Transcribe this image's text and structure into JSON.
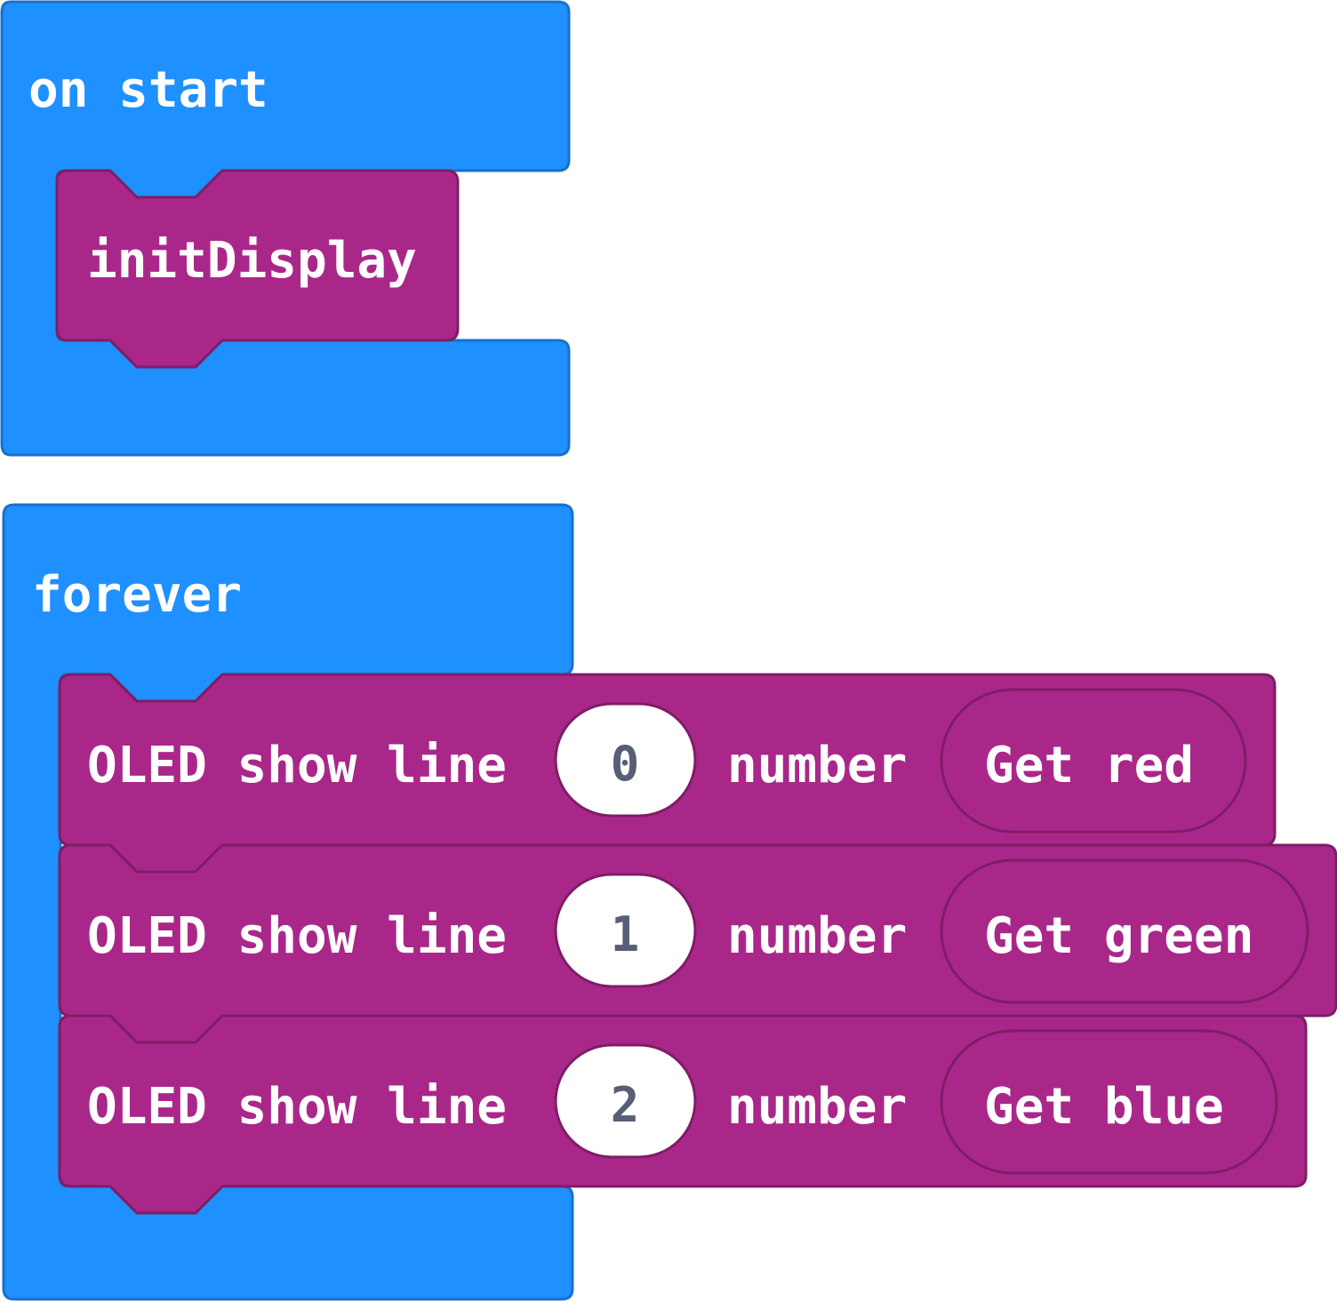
{
  "colors": {
    "event_block": "#1E90FF",
    "event_block_border": "#1871CC",
    "function_block": "#AA278A",
    "function_block_border": "#7E1D66",
    "number_field": "#FFFFFF",
    "number_text": "#575E75",
    "background": "#FFFFFF"
  },
  "on_start": {
    "label": "on start",
    "statements": [
      {
        "label": "initDisplay"
      }
    ]
  },
  "forever": {
    "label": "forever",
    "statements": [
      {
        "prefix": "OLED show line",
        "line": "0",
        "mid": "number",
        "reporter": "Get red"
      },
      {
        "prefix": "OLED show line",
        "line": "1",
        "mid": "number",
        "reporter": "Get green"
      },
      {
        "prefix": "OLED show line",
        "line": "2",
        "mid": "number",
        "reporter": "Get blue"
      }
    ]
  }
}
